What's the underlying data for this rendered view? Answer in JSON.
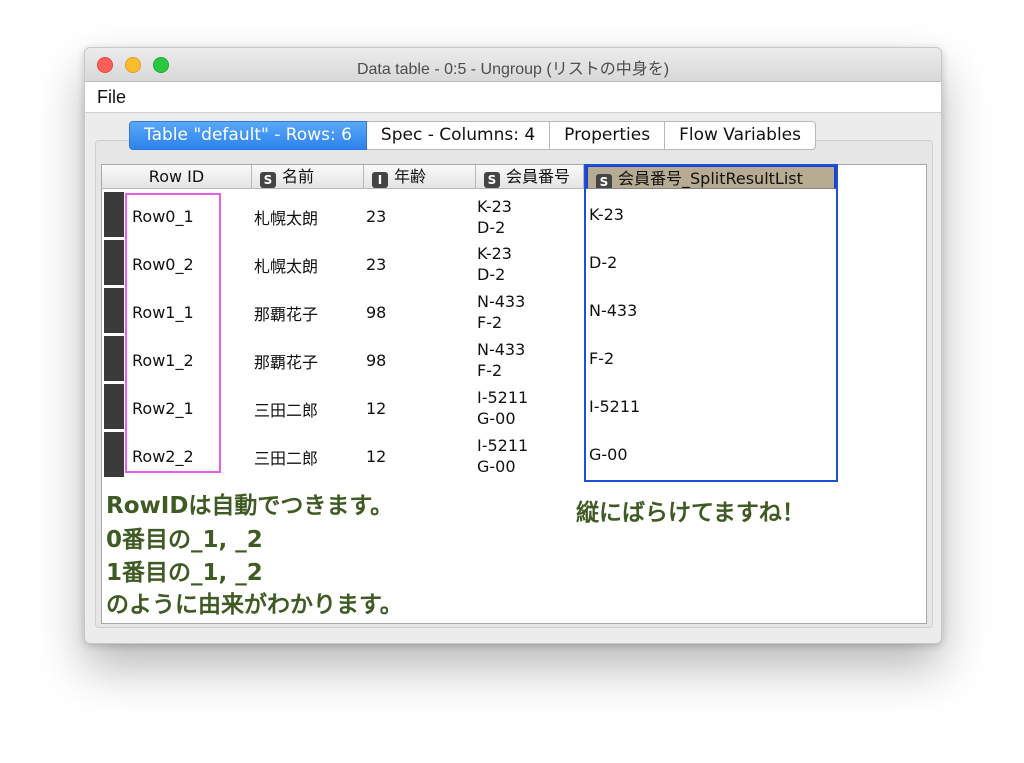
{
  "window": {
    "title": "Data table - 0:5 - Ungroup (リストの中身を)"
  },
  "menu": {
    "file": "File"
  },
  "tabs": [
    {
      "label": "Table \"default\" - Rows: 6"
    },
    {
      "label": "Spec - Columns: 4"
    },
    {
      "label": "Properties"
    },
    {
      "label": "Flow Variables"
    }
  ],
  "table": {
    "headers": [
      {
        "label": "Row ID",
        "icon": ""
      },
      {
        "label": "名前",
        "icon": "S"
      },
      {
        "label": "年齢",
        "icon": "I"
      },
      {
        "label": "会員番号",
        "icon": "S"
      },
      {
        "label": "会員番号_SplitResultList",
        "icon": "S"
      }
    ],
    "rows": [
      {
        "id": "Row0_1",
        "name": "札幌太朗",
        "age": "23",
        "member": [
          "K-23",
          "D-2"
        ],
        "split": "K-23"
      },
      {
        "id": "Row0_2",
        "name": "札幌太朗",
        "age": "23",
        "member": [
          "K-23",
          "D-2"
        ],
        "split": "D-2"
      },
      {
        "id": "Row1_1",
        "name": "那覇花子",
        "age": "98",
        "member": [
          "N-433",
          "F-2"
        ],
        "split": "N-433"
      },
      {
        "id": "Row1_2",
        "name": "那覇花子",
        "age": "98",
        "member": [
          "N-433",
          "F-2"
        ],
        "split": "F-2"
      },
      {
        "id": "Row2_1",
        "name": "三田二郎",
        "age": "12",
        "member": [
          "I-5211",
          "G-00"
        ],
        "split": "I-5211"
      },
      {
        "id": "Row2_2",
        "name": "三田二郎",
        "age": "12",
        "member": [
          "I-5211",
          "G-00"
        ],
        "split": "G-00"
      }
    ]
  },
  "notes": {
    "left": [
      "RowIDは自動でつきます。",
      "0番目の_1, _2",
      "1番目の_1, _2",
      "のように由来がわかります。"
    ],
    "right": "縦にばらけてますね！"
  },
  "colors": {
    "accent": "#2d82ec",
    "annotation_text": "#3f5a22",
    "pink_box": "#e85de8",
    "blue_box": "#1f4fd6"
  }
}
